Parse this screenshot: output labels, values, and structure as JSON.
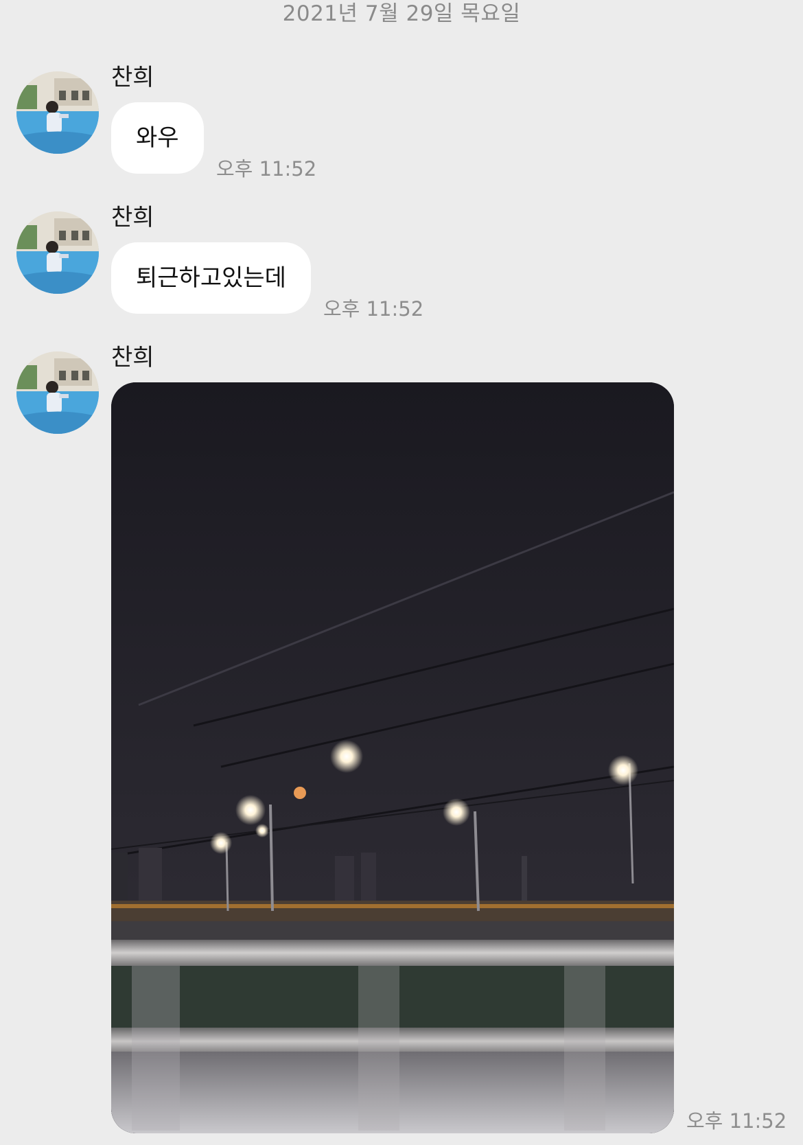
{
  "date_divider": "2021년 7월 29일 목요일",
  "messages": [
    {
      "sender": "찬희",
      "text": "와우",
      "time": "오후 11:52"
    },
    {
      "sender": "찬희",
      "text": "퇴근하고있는데",
      "time": "오후 11:52"
    },
    {
      "sender": "찬희",
      "type": "photo",
      "time": "오후 11:52"
    }
  ],
  "icons": {
    "avatar": "profile-photo-avatar"
  },
  "colors": {
    "background": "#ececec",
    "bubble": "#ffffff",
    "timestamp": "#8d8d8d"
  }
}
